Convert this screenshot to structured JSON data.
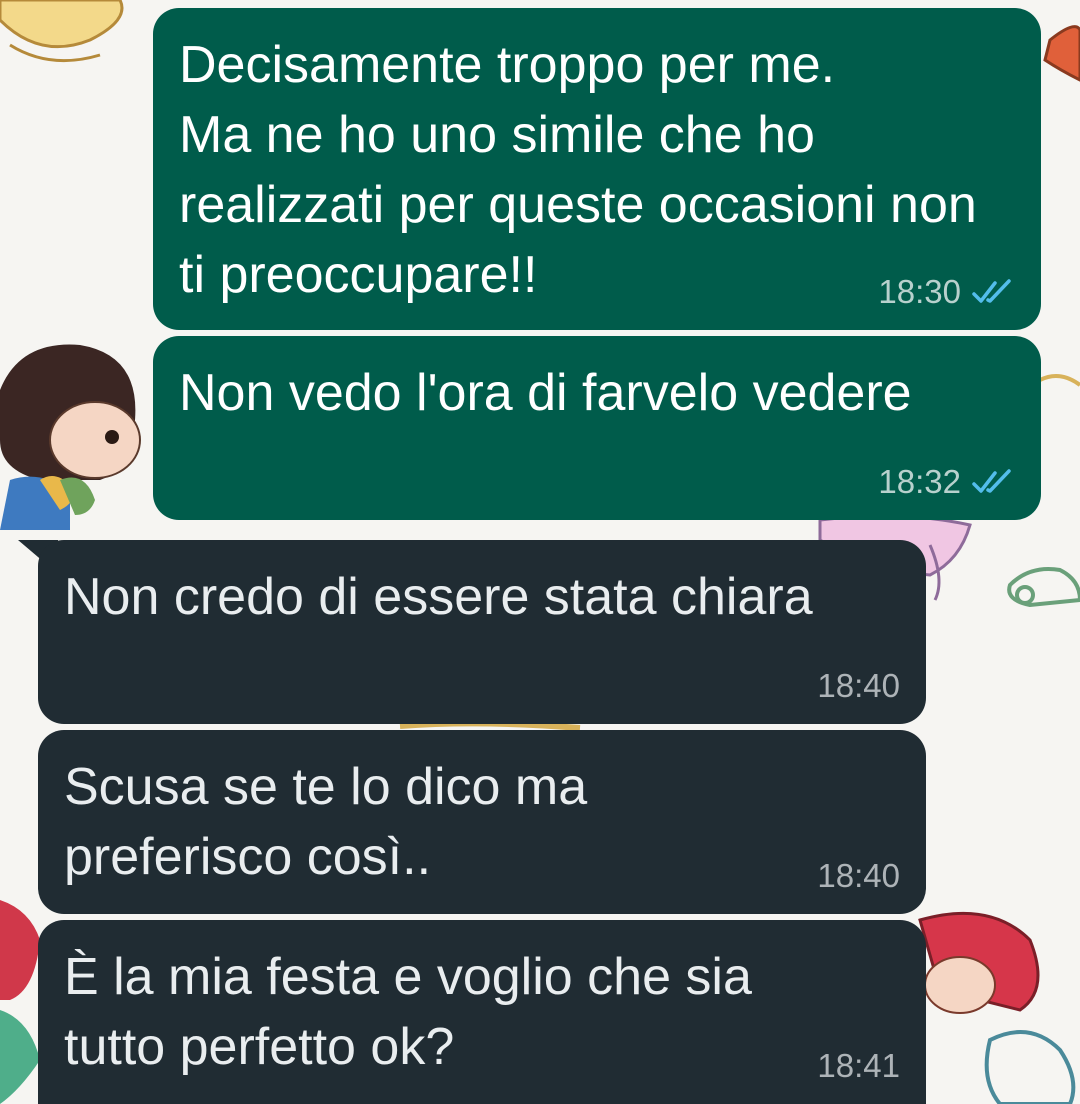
{
  "conversation": {
    "messages": [
      {
        "direction": "outgoing",
        "text": "Decisamente troppo per me.\nMa ne ho uno simile che ho realizzati per queste occasioni non ti preoccupare!!",
        "time": "18:30",
        "status_icon": "double-check-read-icon"
      },
      {
        "direction": "outgoing",
        "text": "Non vedo l'ora di farvelo vedere",
        "time": "18:32",
        "status_icon": "double-check-read-icon"
      },
      {
        "direction": "incoming",
        "text": "Non credo di essere stata chiara",
        "time": "18:40"
      },
      {
        "direction": "incoming",
        "text": "Scusa se te lo dico ma preferisco così..",
        "time": "18:40"
      },
      {
        "direction": "incoming",
        "text": "È la mia festa e voglio che sia tutto perfetto ok?",
        "time": "18:41"
      }
    ]
  },
  "colors": {
    "outgoing_bubble": "#005c4b",
    "incoming_bubble": "#202c33",
    "read_ticks": "#53bdeb",
    "wallpaper": "#f6f5f2"
  }
}
